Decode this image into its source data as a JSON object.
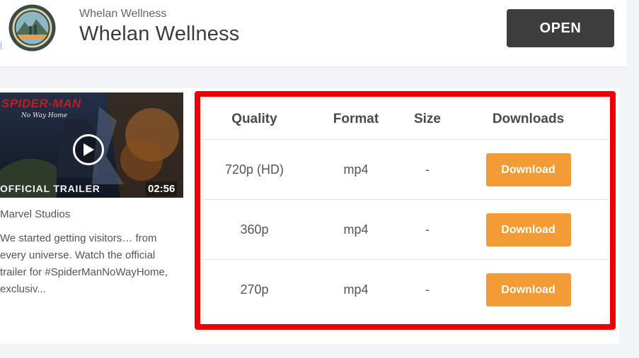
{
  "ad": {
    "advertiser": "Whelan Wellness",
    "headline": "Whelan Wellness",
    "cta": "OPEN",
    "logo_icon": "whelan-wellness-logo"
  },
  "video": {
    "title_art": "SPIDER-MAN",
    "subtitle_art": "No Way Home",
    "label": "OFFICIAL TRAILER",
    "duration": "02:56",
    "channel": "Marvel Studios",
    "description": "We started getting visitors… from every universe. Watch the official trailer for #SpiderManNoWayHome, exclusiv..."
  },
  "table": {
    "headers": [
      "Quality",
      "Format",
      "Size",
      "Downloads"
    ],
    "rows": [
      {
        "quality": "720p (HD)",
        "format": "mp4",
        "size": "-",
        "action": "Download"
      },
      {
        "quality": "360p",
        "format": "mp4",
        "size": "-",
        "action": "Download"
      },
      {
        "quality": "270p",
        "format": "mp4",
        "size": "-",
        "action": "Download"
      }
    ]
  },
  "colors": {
    "highlight": "#ee0000",
    "download_button": "#f39b35",
    "open_button": "#3d3d3d"
  }
}
